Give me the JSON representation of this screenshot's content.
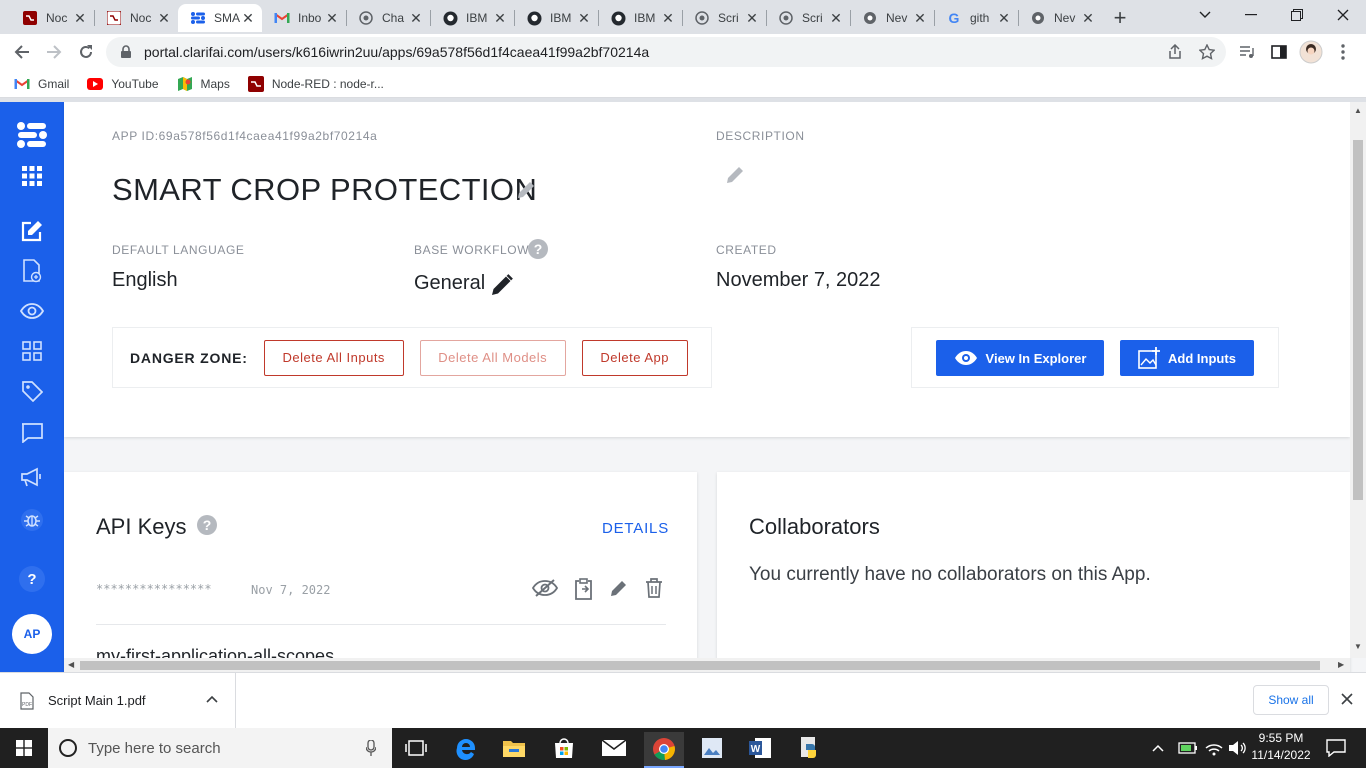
{
  "browser": {
    "tabs": [
      {
        "title": "Noc"
      },
      {
        "title": "Noc"
      },
      {
        "title": "SMA"
      },
      {
        "title": "Inbo"
      },
      {
        "title": "Cha"
      },
      {
        "title": "IBM"
      },
      {
        "title": "IBM"
      },
      {
        "title": "IBM"
      },
      {
        "title": "Scri"
      },
      {
        "title": "Scri"
      },
      {
        "title": "Nev"
      },
      {
        "title": "gith"
      },
      {
        "title": "Nev"
      }
    ],
    "url": "portal.clarifai.com/users/k616iwrin2uu/apps/69a578f56d1f4caea41f99a2bf70214a",
    "bookmarks": [
      {
        "label": "Gmail"
      },
      {
        "label": "YouTube"
      },
      {
        "label": "Maps"
      },
      {
        "label": "Node-RED : node-r..."
      }
    ]
  },
  "sidebar": {
    "avatar": "AP",
    "help": "?"
  },
  "app": {
    "app_id": "APP ID:69a578f56d1f4caea41f99a2bf70214a",
    "name": "SMART CROP PROTECTION",
    "description_label": "DESCRIPTION",
    "default_language_label": "DEFAULT LANGUAGE",
    "default_language": "English",
    "base_workflow_label": "BASE WORKFLOW",
    "base_workflow": "General",
    "created_label": "CREATED",
    "created": "November 7, 2022"
  },
  "danger_zone": {
    "label": "DANGER ZONE:",
    "delete_inputs": "Delete All Inputs",
    "delete_models": "Delete All Models",
    "delete_app": "Delete App"
  },
  "actions": {
    "view_explorer": "View In Explorer",
    "add_inputs": "Add Inputs"
  },
  "api_keys": {
    "title": "API Keys",
    "details": "DETAILS",
    "key_masked": "****************",
    "key_date": "Nov 7, 2022",
    "key_name": "my-first-application-all-scopes"
  },
  "collaborators": {
    "title": "Collaborators",
    "empty_text": "You currently have no collaborators on this App."
  },
  "download": {
    "filename": "Script Main 1.pdf",
    "show_all": "Show all"
  },
  "taskbar": {
    "search_placeholder": "Type here to search",
    "time": "9:55 PM",
    "date": "11/14/2022"
  },
  "colors": {
    "brand_blue": "#1b60ea",
    "danger_red": "#c0392b"
  }
}
